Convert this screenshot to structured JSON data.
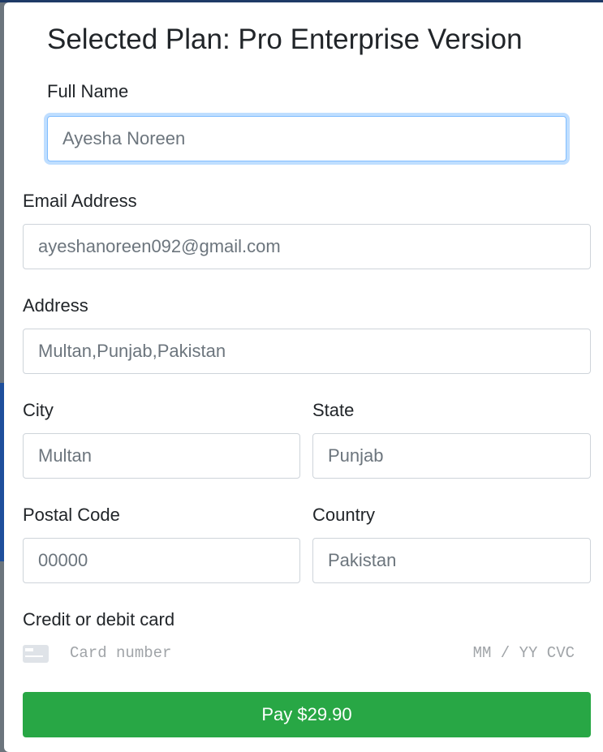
{
  "modal": {
    "title": "Selected Plan: Pro Enterprise Version"
  },
  "form": {
    "full_name": {
      "label": "Full Name",
      "placeholder": "Ayesha Noreen"
    },
    "email": {
      "label": "Email Address",
      "placeholder": "ayeshanoreen092@gmail.com"
    },
    "address": {
      "label": "Address",
      "placeholder": "Multan,Punjab,Pakistan"
    },
    "city": {
      "label": "City",
      "placeholder": "Multan"
    },
    "state": {
      "label": "State",
      "placeholder": "Punjab"
    },
    "postal_code": {
      "label": "Postal Code",
      "placeholder": "00000"
    },
    "country": {
      "label": "Country",
      "placeholder": "Pakistan"
    },
    "card": {
      "label": "Credit or debit card",
      "number_placeholder": "Card number",
      "expiry_cvc_placeholder": "MM / YY CVC",
      "icon": "credit-card-icon"
    },
    "pay_button": "Pay $29.90"
  },
  "colors": {
    "pay_button": "#28a745",
    "focus_border": "#80bdff",
    "input_border": "#ced4da"
  }
}
